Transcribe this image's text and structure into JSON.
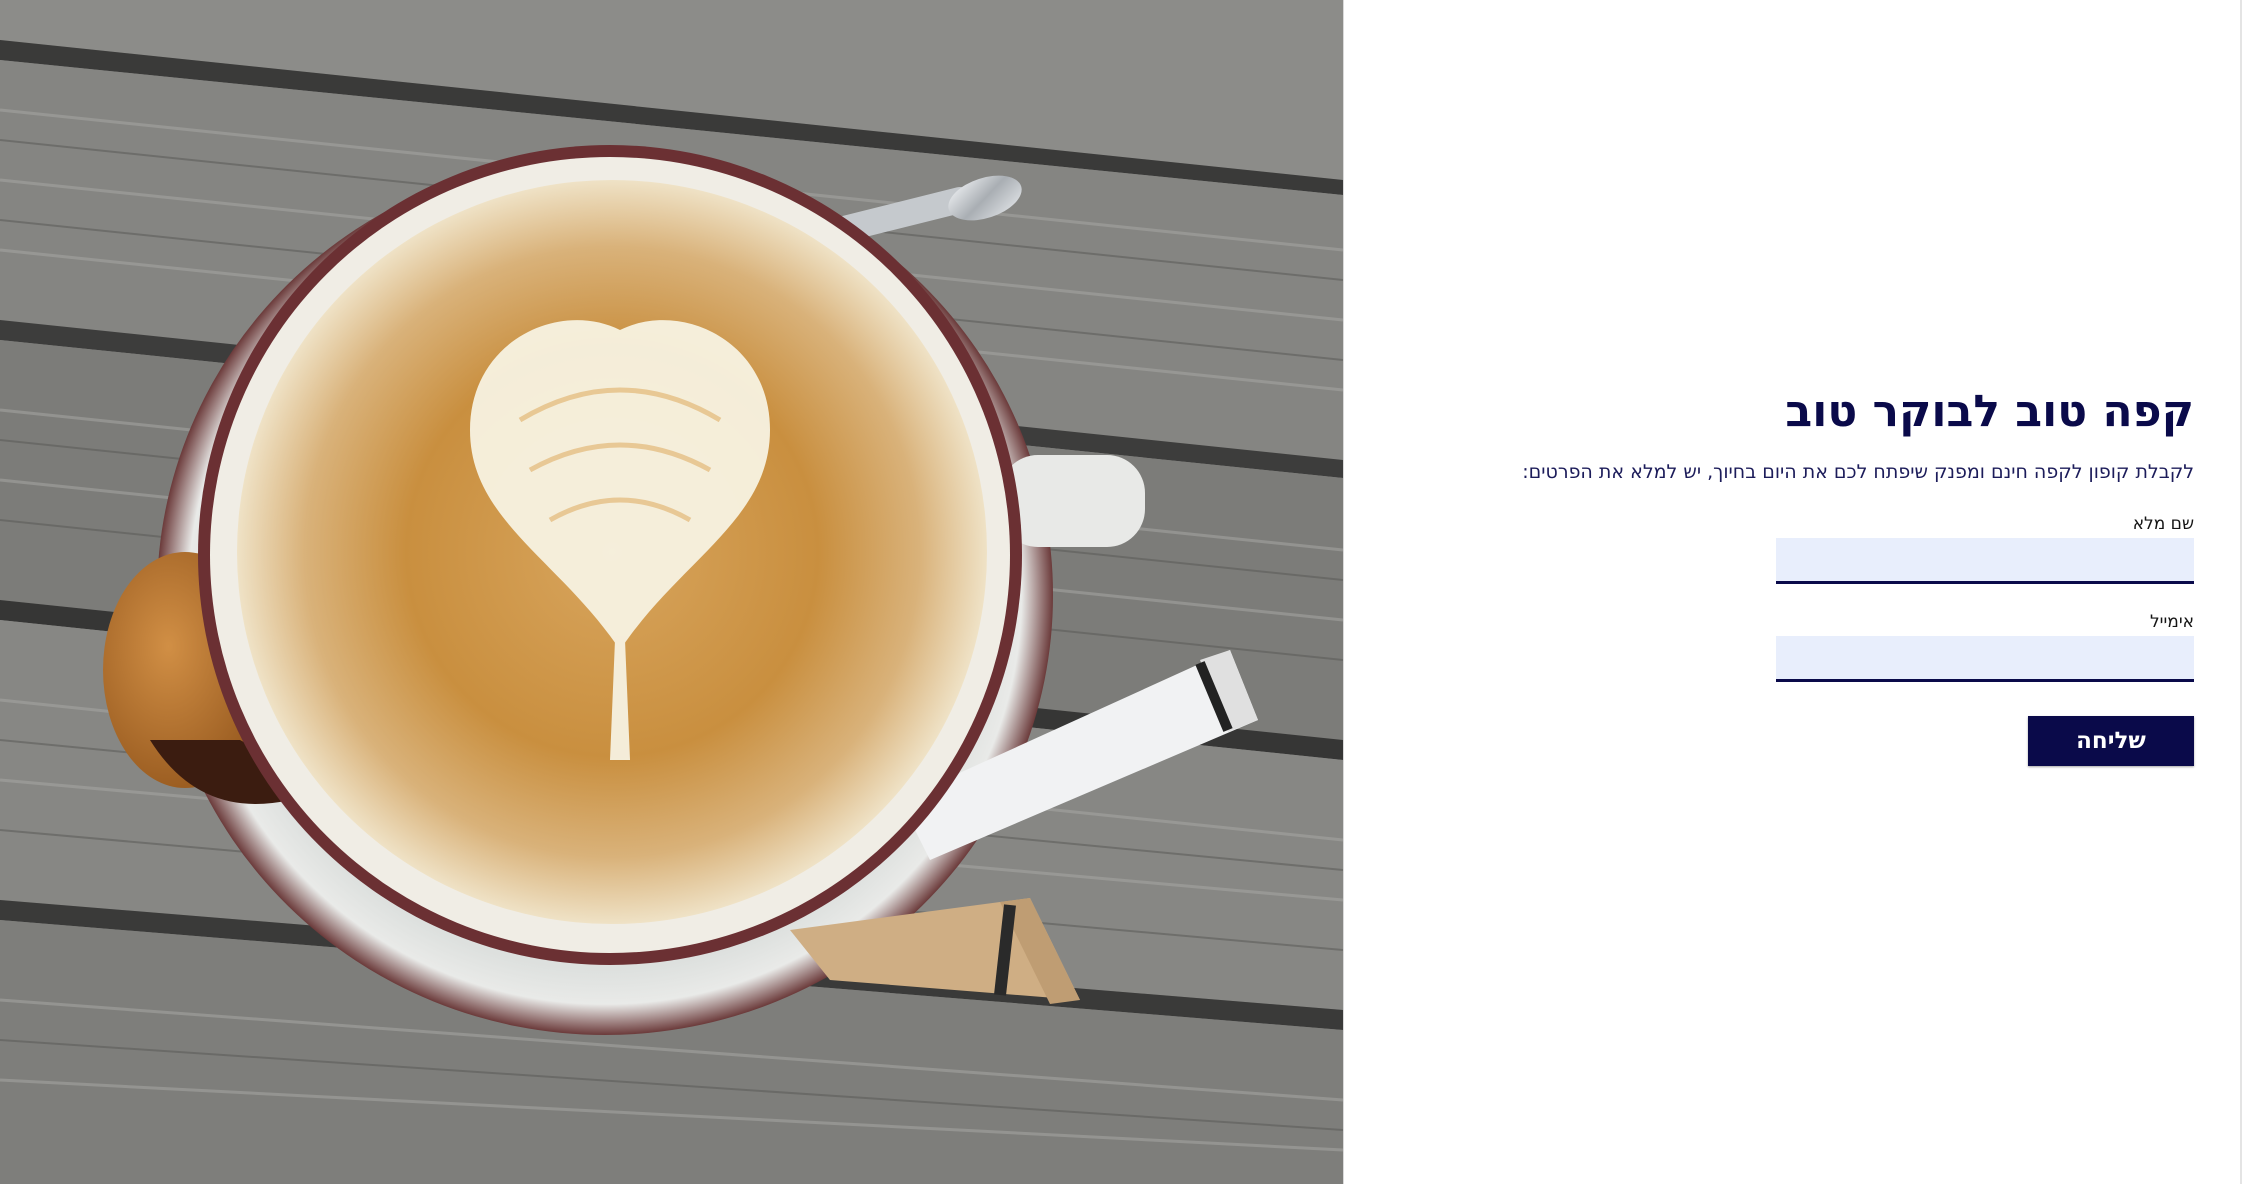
{
  "photo": {
    "alt": "coffee-latte-photo"
  },
  "form": {
    "headline": "קפה טוב לבוקר טוב",
    "subtitle": "לקבלת קופון לקפה חינם ומפנק שיפתח לכם את היום בחיוך, יש למלא את הפרטים:",
    "name_label": "שם מלא",
    "name_value": "",
    "email_label": "אימייל",
    "email_value": "",
    "submit_label": "שליחה"
  },
  "colors": {
    "primary": "#0a0a4a",
    "input_bg": "#e8eefc",
    "subtitle": "#1c1c5a"
  }
}
